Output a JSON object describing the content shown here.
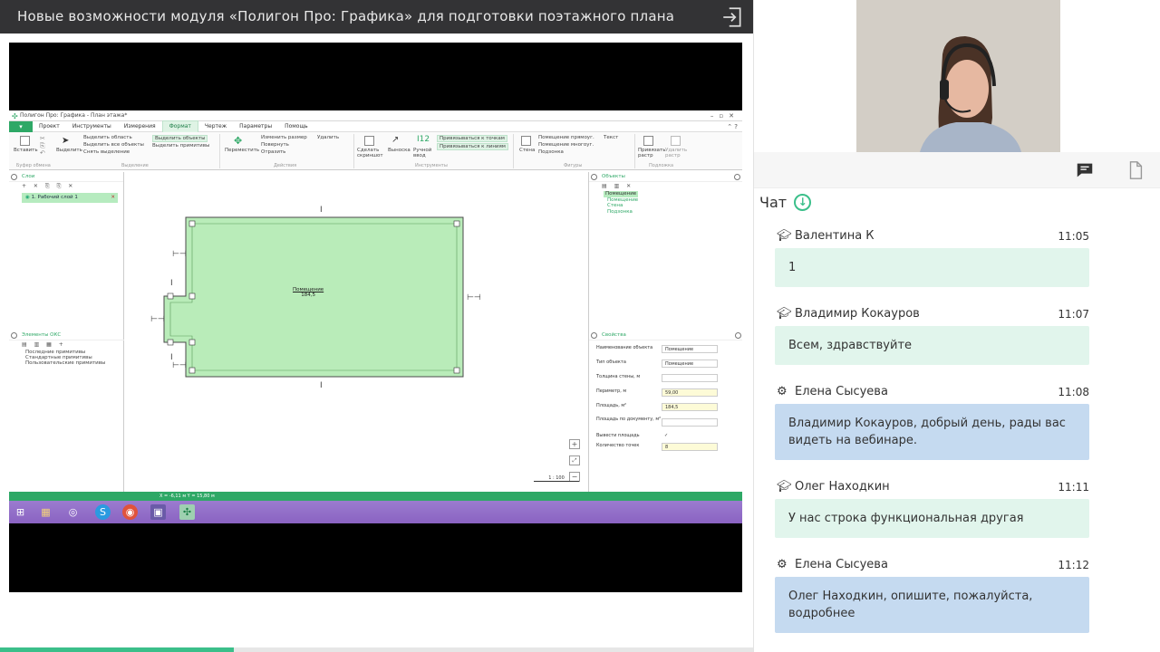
{
  "header": {
    "title": "Новые возможности модуля «Полигон Про: Графика» для подготовки поэтажного плана"
  },
  "progress": {
    "fraction": 0.31
  },
  "app": {
    "window_title": "Полигон Про: Графика - План этажа*",
    "menu": [
      "Проект",
      "Инструменты",
      "Измерения",
      "Формат",
      "Чертеж",
      "Параметры",
      "Помощь"
    ],
    "active_menu": "Формат",
    "ribbon": {
      "paste": "Вставить",
      "select": "Выделить",
      "select_area": "Выделить область",
      "select_all": "Выделить все объекты",
      "deselect": "Снять выделение",
      "select_objects": "Выделить объекты",
      "select_primitives": "Выделить примитивы",
      "move": "Переместить",
      "resize": "Изменить размер",
      "delete": "Удалить",
      "rotate": "Повернуть",
      "mirror": "Отразить",
      "screenshot": "Сделать скриншот",
      "callout": "Выноска",
      "manual_input": "Ручной ввод",
      "snap_points": "Привязываться к точкам",
      "snap_lines": "Привязываться к линиям",
      "wall": "Стена",
      "room_rect": "Помещение прямоуг.",
      "room_poly": "Помещение многоуг.",
      "subroom": "Подзонка",
      "text": "Текст",
      "bind_raster": "Привязать растр",
      "delete_raster": "Удалить растр",
      "group_clipboard": "Буфер обмена",
      "group_select": "Выделение",
      "group_actions": "Действия",
      "group_tools": "Инструменты",
      "group_shapes": "Фигуры",
      "group_underlay": "Подложка"
    },
    "layers_panel": {
      "title": "Слои",
      "layer": "1. Рабочий слой 1"
    },
    "elements_panel": {
      "title": "Элементы ОКС",
      "items": [
        "Последние примитивы",
        "Стандартные примитивы",
        "Пользовательские примитивы"
      ]
    },
    "objects_panel": {
      "title": "Объекты",
      "items": [
        "Помещение",
        "Помещение",
        "Стена",
        "Подзонка"
      ]
    },
    "properties_panel": {
      "title": "Свойства",
      "rows": [
        {
          "label": "Наименование объекта",
          "value": "Помещение"
        },
        {
          "label": "Тип объекта",
          "value": "Помещение"
        },
        {
          "label": "Толщина стены, м",
          "value": ""
        },
        {
          "label": "Периметр, м",
          "value": "59,00"
        },
        {
          "label": "Площадь, м²",
          "value": "184,5"
        },
        {
          "label": "Площадь по документу, м²",
          "value": ""
        },
        {
          "label": "Вывести площадь",
          "value": "✓"
        },
        {
          "label": "Количество точек",
          "value": "8"
        }
      ]
    },
    "room_label": "Помещение",
    "room_area": "184,5",
    "scale": "1 : 100",
    "status": "X = -6,11 м    Y = 15,80 м"
  },
  "chat": {
    "title": "Чат",
    "messages": [
      {
        "author": "Валентина К",
        "time": "11:05",
        "text": "1",
        "role": "student"
      },
      {
        "author": "Владимир Кокауров",
        "time": "11:07",
        "text": "Всем, здравствуйте",
        "role": "student"
      },
      {
        "author": "Елена Сысуева",
        "time": "11:08",
        "text": "Владимир Кокауров, добрый день, рады вас видеть на вебинаре.",
        "role": "moderator"
      },
      {
        "author": "Олег Находкин",
        "time": "11:11",
        "text": "У нас строка функциональная другая",
        "role": "student"
      },
      {
        "author": "Елена Сысуева",
        "time": "11:12",
        "text": "Олег Находкин, опишите, пожалуйста, водробнее",
        "role": "moderator"
      }
    ]
  },
  "colors": {
    "accent": "#3bbf8a",
    "app_green": "#2ea866",
    "bubble_green": "#e1f5ec",
    "bubble_blue": "#c5daf0"
  }
}
